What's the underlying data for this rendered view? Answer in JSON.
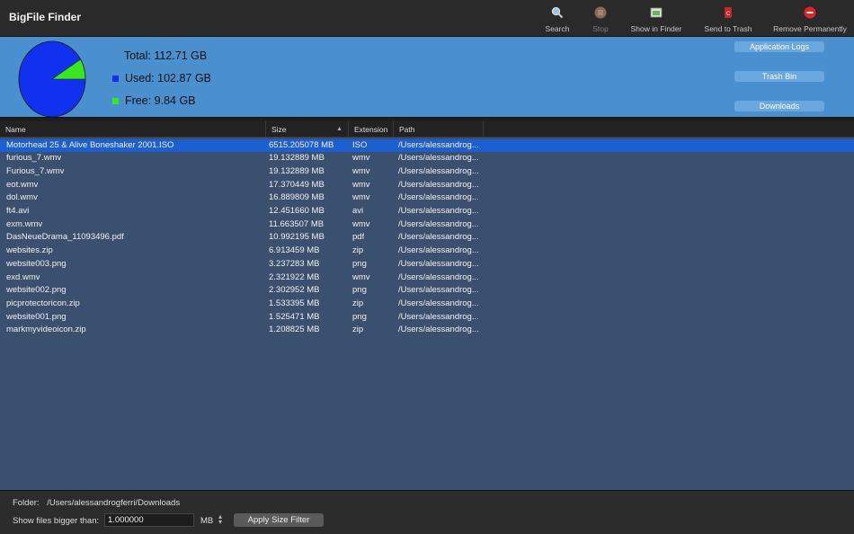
{
  "app": {
    "title": "BigFile Finder"
  },
  "toolbar": {
    "search_label": "Search",
    "stop_label": "Stop",
    "show_in_finder_label": "Show in Finder",
    "send_to_trash_label": "Send to Trash",
    "remove_permanently_label": "Remove Permanently"
  },
  "disk": {
    "total_label": "Total: 112.71 GB",
    "used_label": "Used: 102.87 GB",
    "free_label": "Free: 9.84 GB",
    "used_fraction": 0.9127,
    "used_color": "#1032f0",
    "free_color": "#36e81c"
  },
  "side_buttons": {
    "application_logs": "Application Logs",
    "trash_bin": "Trash Bin",
    "downloads": "Downloads"
  },
  "table": {
    "columns": {
      "name": "Name",
      "size": "Size",
      "extension": "Extension",
      "path": "Path"
    },
    "rows": [
      {
        "name": "Motorhead 25 & Alive Boneshaker 2001.ISO",
        "size": "6515.205078 MB",
        "ext": "ISO",
        "path": "/Users/alessandrog...",
        "selected": true
      },
      {
        "name": "furious_7.wmv",
        "size": "19.132889 MB",
        "ext": "wmv",
        "path": "/Users/alessandrog..."
      },
      {
        "name": "Furious_7.wmv",
        "size": "19.132889 MB",
        "ext": "wmv",
        "path": "/Users/alessandrog..."
      },
      {
        "name": "eot.wmv",
        "size": "17.370449 MB",
        "ext": "wmv",
        "path": "/Users/alessandrog..."
      },
      {
        "name": "dol.wmv",
        "size": "16.889809 MB",
        "ext": "wmv",
        "path": "/Users/alessandrog..."
      },
      {
        "name": "ft4.avi",
        "size": "12.451660 MB",
        "ext": "avi",
        "path": "/Users/alessandrog..."
      },
      {
        "name": "exm.wmv",
        "size": "11.663507 MB",
        "ext": "wmv",
        "path": "/Users/alessandrog..."
      },
      {
        "name": "DasNeueDrama_11093496.pdf",
        "size": "10.992195 MB",
        "ext": "pdf",
        "path": "/Users/alessandrog..."
      },
      {
        "name": "websites.zip",
        "size": "6.913459 MB",
        "ext": "zip",
        "path": "/Users/alessandrog..."
      },
      {
        "name": "website003.png",
        "size": "3.237283 MB",
        "ext": "png",
        "path": "/Users/alessandrog..."
      },
      {
        "name": "exd.wmv",
        "size": "2.321922 MB",
        "ext": "wmv",
        "path": "/Users/alessandrog..."
      },
      {
        "name": "website002.png",
        "size": "2.302952 MB",
        "ext": "png",
        "path": "/Users/alessandrog..."
      },
      {
        "name": "picprotectoricon.zip",
        "size": "1.533395 MB",
        "ext": "zip",
        "path": "/Users/alessandrog..."
      },
      {
        "name": "website001.png",
        "size": "1.525471 MB",
        "ext": "png",
        "path": "/Users/alessandrog..."
      },
      {
        "name": "markmyvideoicon.zip",
        "size": "1.208825 MB",
        "ext": "zip",
        "path": "/Users/alessandrog..."
      }
    ]
  },
  "footer": {
    "folder_label": "Folder:",
    "folder_value": "/Users/alessandrogferri/Downloads",
    "filter_label": "Show files bigger than:",
    "filter_value": "1.000000",
    "unit": "MB",
    "apply_label": "Apply Size Filter"
  }
}
